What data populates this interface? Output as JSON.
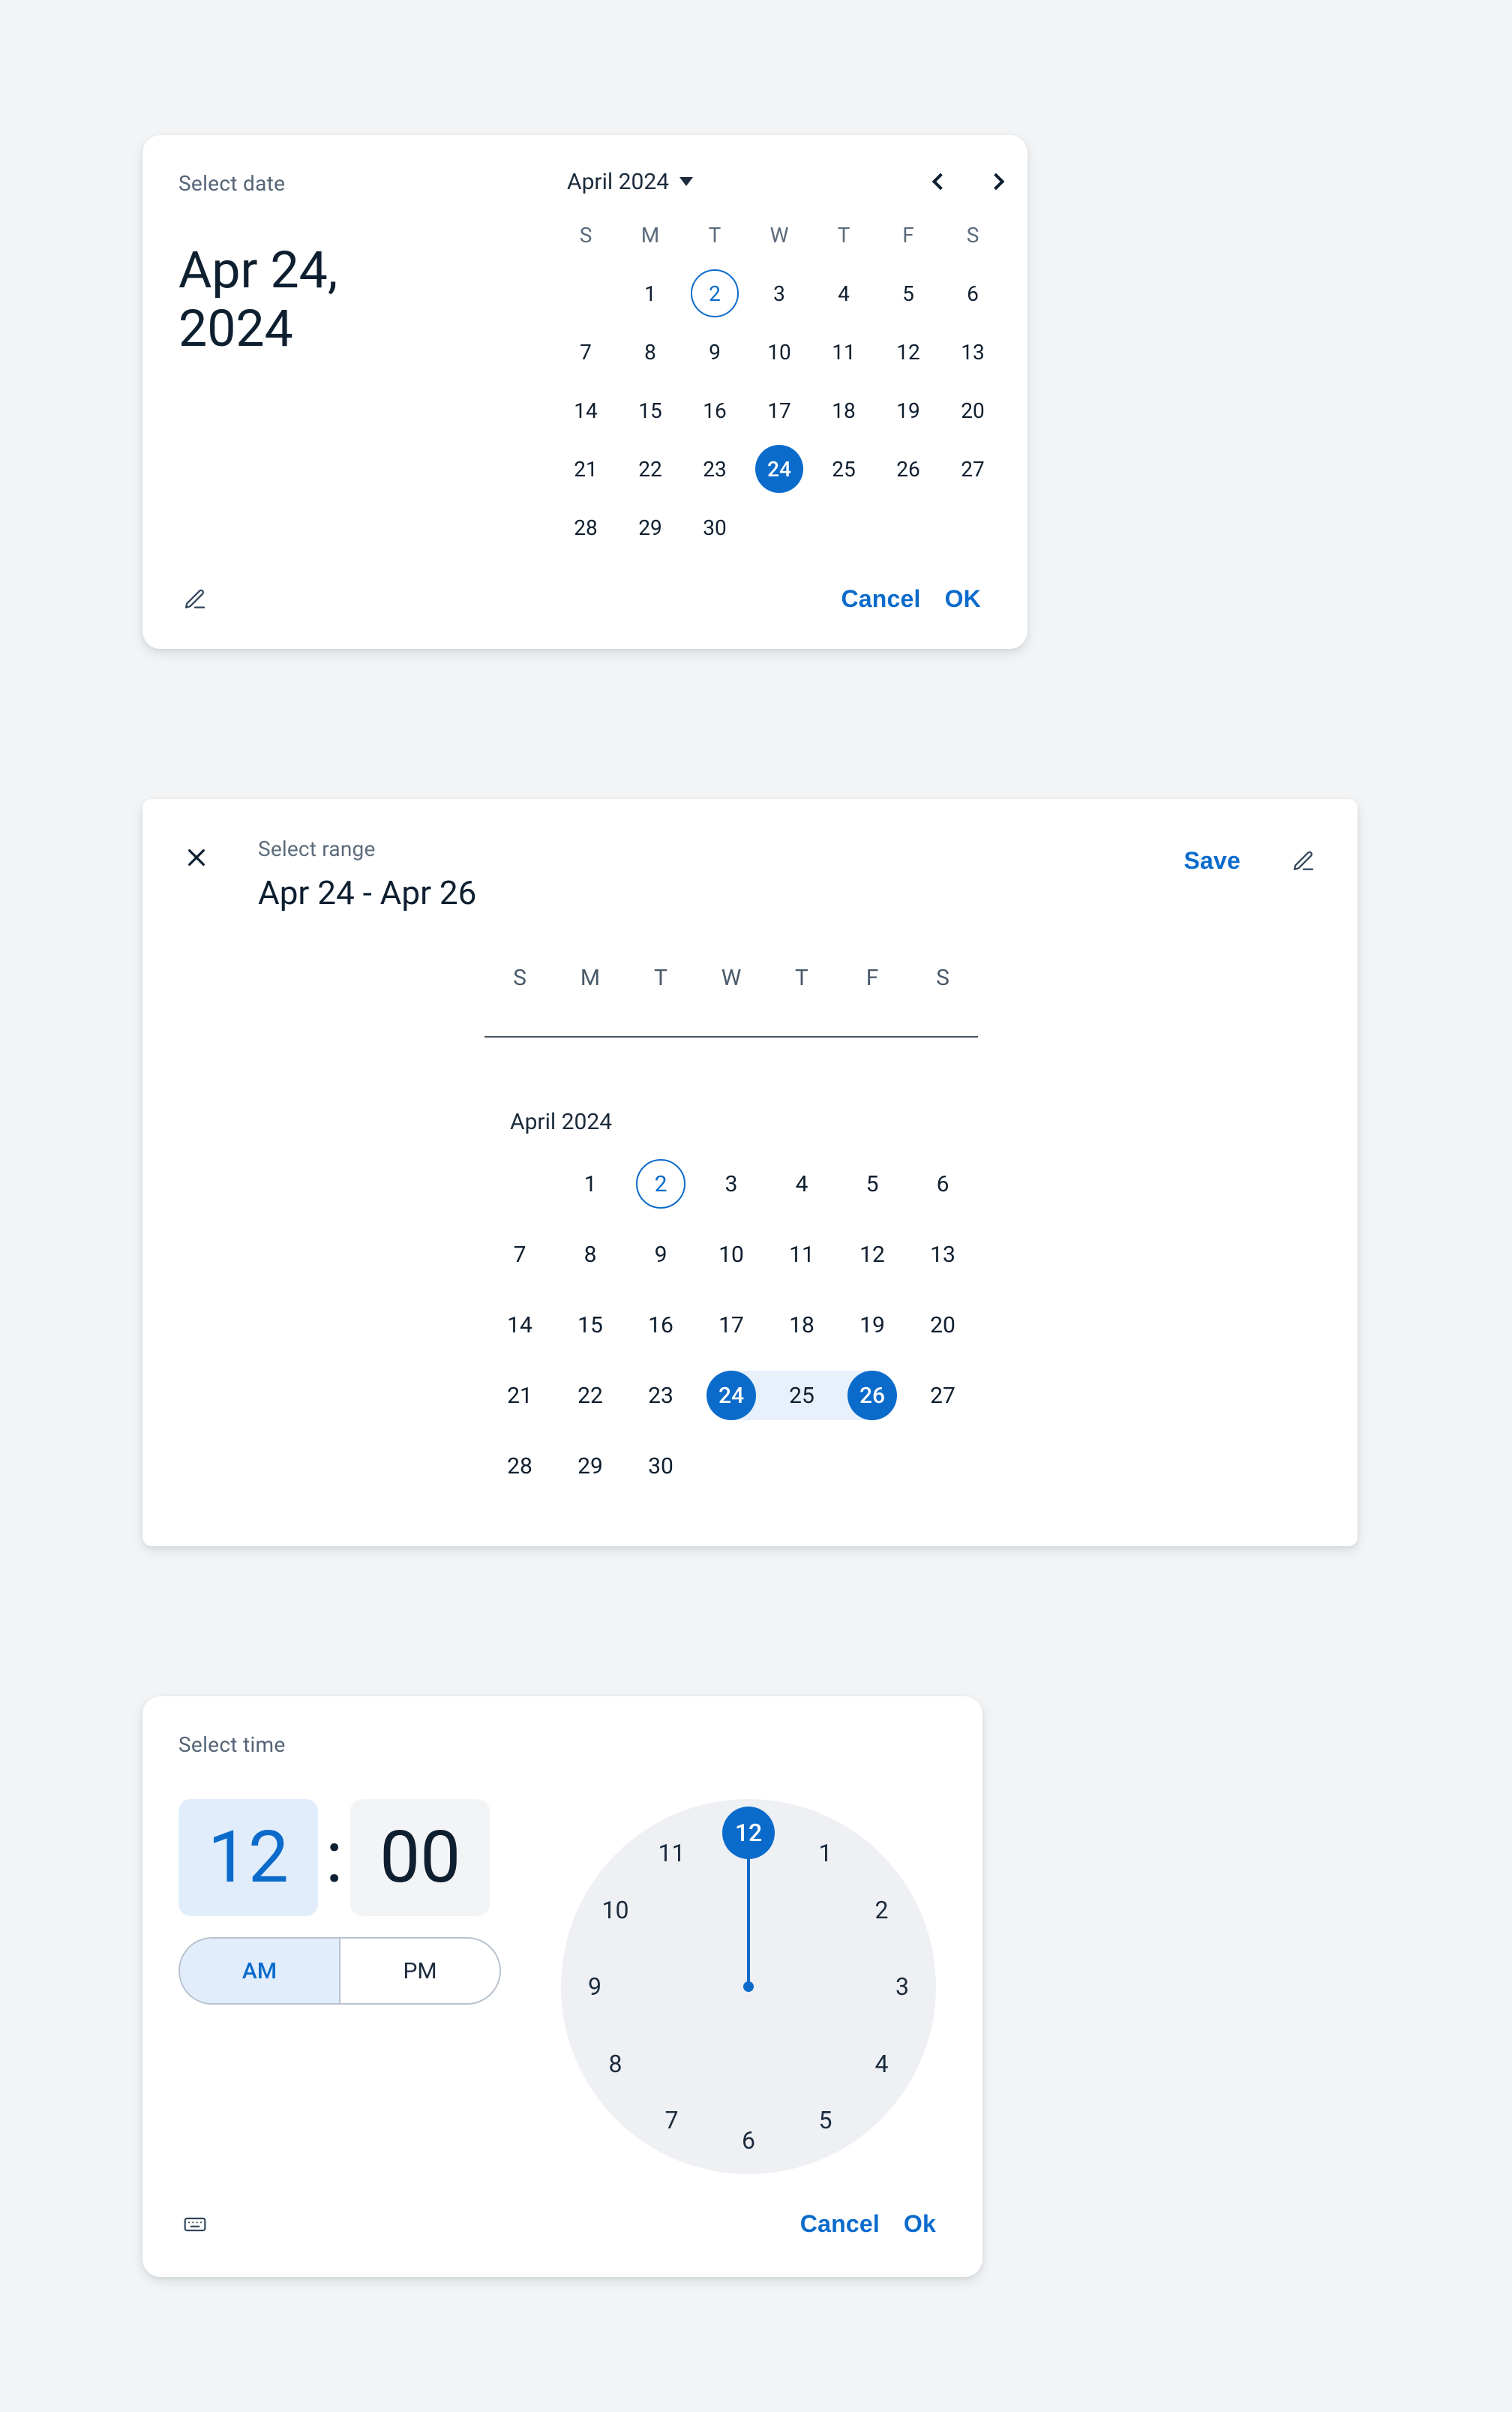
{
  "colors": {
    "primary": "#0b6bcb"
  },
  "datepicker": {
    "supporting": "Select date",
    "headline_line1": "Apr 24,",
    "headline_line2": "2024",
    "month_label": "April 2024",
    "weekdays": [
      "S",
      "M",
      "T",
      "W",
      "T",
      "F",
      "S"
    ],
    "start_offset": 1,
    "days_in_month": 30,
    "today": 2,
    "selected": 24,
    "cancel_label": "Cancel",
    "ok_label": "OK"
  },
  "range": {
    "supporting": "Select range",
    "headline": "Apr 24 - Apr 26",
    "save_label": "Save",
    "month_label": "April 2024",
    "weekdays": [
      "S",
      "M",
      "T",
      "W",
      "T",
      "F",
      "S"
    ],
    "start_offset": 1,
    "days_in_month": 30,
    "today": 2,
    "start": 24,
    "end": 26
  },
  "time": {
    "supporting": "Select time",
    "hour": "12",
    "minute": "00",
    "am_label": "AM",
    "pm_label": "PM",
    "period": "AM",
    "selected_hour": 12,
    "hours": [
      12,
      1,
      2,
      3,
      4,
      5,
      6,
      7,
      8,
      9,
      10,
      11
    ],
    "cancel_label": "Cancel",
    "ok_label": "Ok"
  }
}
